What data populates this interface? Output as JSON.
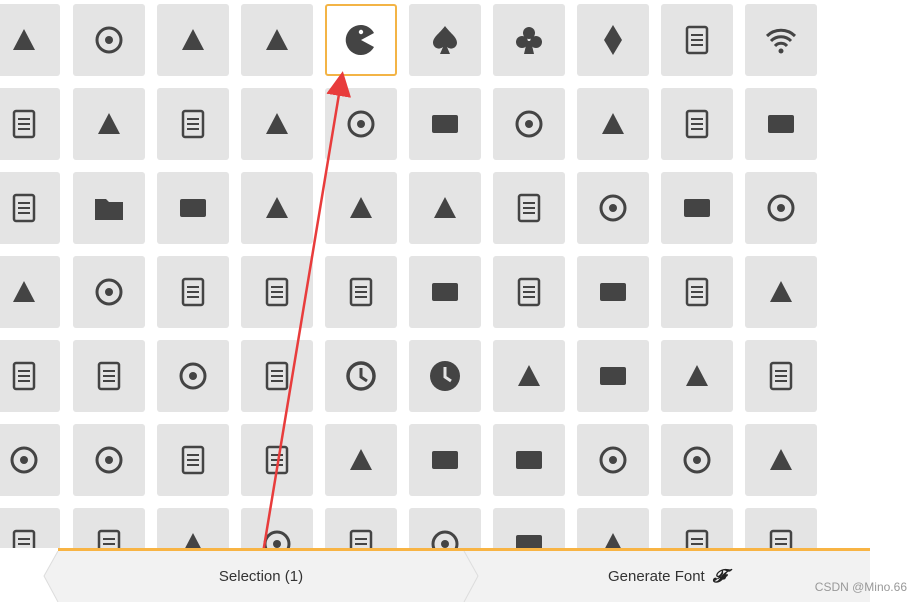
{
  "footer": {
    "selection_label": "Selection (1)",
    "generate_label": "Generate Font",
    "generate_glyph": "𝓕"
  },
  "watermark": "CSDN @Mino.66",
  "accent_color": "#f8b444",
  "selected_border_color": "#f3b446",
  "annotation_color": "#e83c3c",
  "grid_rows": [
    [
      "youtube-icon",
      "film-icon",
      "video-camera-icon",
      "dice-icon",
      "pacman-icon",
      "spades-icon",
      "clubs-icon",
      "diamonds-icon",
      "bullhorn-icon",
      "wifi-icon"
    ],
    [
      "books-icon",
      "library-icon",
      "file-text-icon",
      "profile-icon",
      "file-empty-icon",
      "files-empty-icon",
      "file-text2-icon",
      "file-picture-icon",
      "file-music-icon",
      "file-play-icon"
    ],
    [
      "stack-icon",
      "folder-icon",
      "folder-open-icon",
      "folder-plus-icon",
      "folder-minus-icon",
      "folder-download-icon",
      "folder-upload-icon",
      "price-tag-icon",
      "price-tags-icon",
      "barcode-icon"
    ],
    [
      "coin-euro-icon",
      "coin-pound-icon",
      "coin-yen-icon",
      "credit-card-icon",
      "calculator-icon",
      "lifebuoy-icon",
      "phone-icon",
      "phone-hang-up-icon",
      "address-book-icon",
      "envelop-icon"
    ],
    [
      "compass-icon",
      "map-icon",
      "map2-icon",
      "history-icon",
      "clock-icon",
      "clock2-icon",
      "alarm-icon",
      "bell-icon",
      "stopwatch-icon",
      "calendar-icon"
    ],
    [
      "mobile-icon",
      "tablet-icon",
      "tablet2-icon",
      "tv-icon",
      "drawer-icon",
      "drawer2-icon",
      "box-add-icon",
      "box-remove-icon",
      "download-icon",
      "upload-icon"
    ],
    [
      "redo-icon",
      "undo-icon",
      "forward-icon",
      "reply-icon",
      "enter-icon",
      "bubble-icon",
      "bubbles-icon",
      "bubbles2-icon",
      "bubble2-icon",
      "bubbles3-icon"
    ]
  ],
  "selected_icon": "pacman-icon"
}
